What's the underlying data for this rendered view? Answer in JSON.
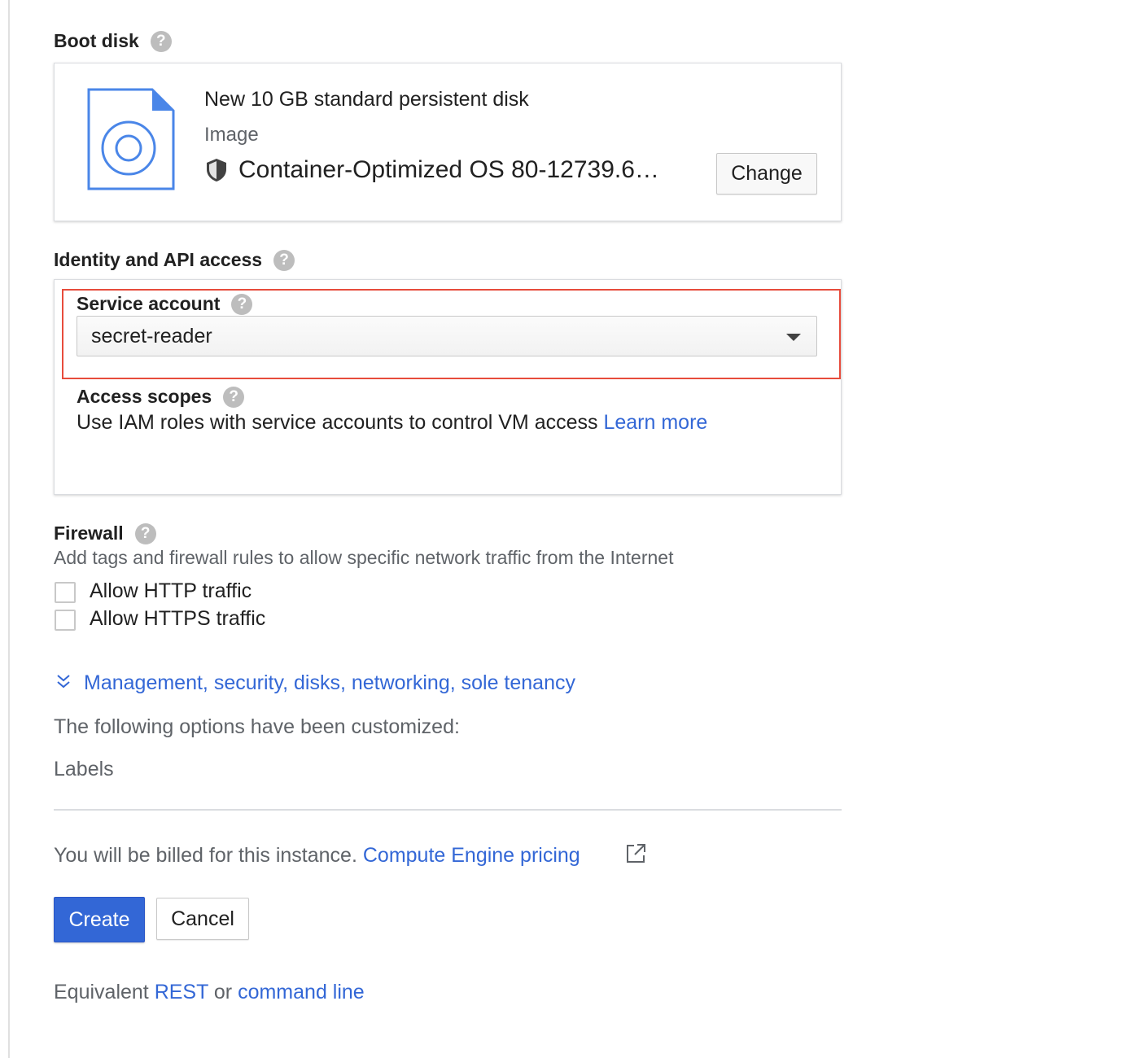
{
  "boot_disk": {
    "title": "Boot disk",
    "disk_description": "New 10 GB standard persistent disk",
    "image_label": "Image",
    "image_name": "Container-Optimized OS 80-12739.6…",
    "change_label": "Change"
  },
  "identity": {
    "title": "Identity and API access",
    "service_account_label": "Service account",
    "service_account_value": "secret-reader",
    "access_scopes_label": "Access scopes",
    "access_scopes_text": "Use IAM roles with service accounts to control VM access",
    "learn_more": "Learn more"
  },
  "firewall": {
    "title": "Firewall",
    "description": "Add tags and firewall rules to allow specific network traffic from the Internet",
    "options": [
      {
        "label": "Allow HTTP traffic",
        "checked": false
      },
      {
        "label": "Allow HTTPS traffic",
        "checked": false
      }
    ]
  },
  "management": {
    "link": "Management, security, disks, networking, sole tenancy",
    "customized_text": "The following options have been customized:",
    "customized_item": "Labels"
  },
  "billing": {
    "text": "You will be billed for this instance.",
    "pricing_link": "Compute Engine pricing"
  },
  "actions": {
    "create_label": "Create",
    "cancel_label": "Cancel"
  },
  "equivalent": {
    "prefix": "Equivalent",
    "rest_link": "REST",
    "or_text": "or",
    "command_line_link": "command line"
  },
  "help_glyph": "?",
  "colors": {
    "accent": "#3367d6",
    "highlight_outline": "#e74c3c"
  }
}
